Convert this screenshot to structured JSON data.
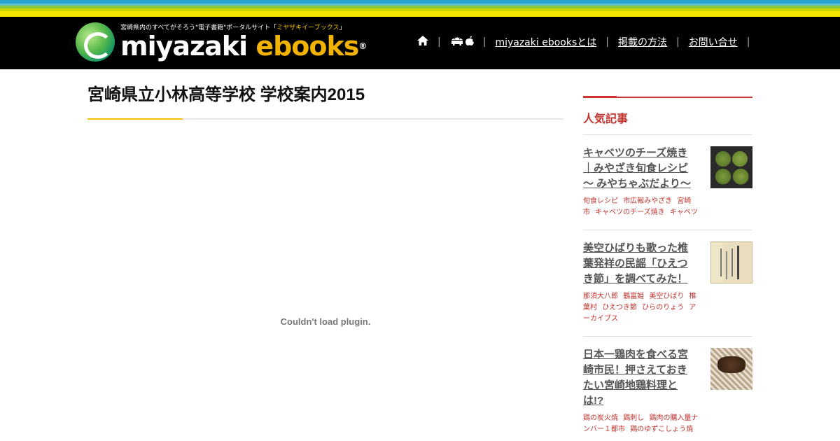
{
  "header": {
    "tagline_prefix": "宮崎県内のすべてがそろう\"電子書籍\"ポータルサイト「",
    "tagline_highlight": "ミヤザキイーブックス",
    "tagline_suffix": "」",
    "brand_part1": "miyazaki",
    "brand_part2": "ebooks",
    "brand_mark": "®"
  },
  "nav": {
    "home_icon": "home-icon",
    "apps_icon": "android-apple-icon",
    "separator": "|",
    "items": [
      {
        "label": "miyazaki ebooksとは"
      },
      {
        "label": "掲載の方法"
      },
      {
        "label": "お問い合せ"
      }
    ]
  },
  "main": {
    "title": "宮崎県立小林高等学校 学校案内2015",
    "plugin_message": "Couldn't load plugin."
  },
  "sidebar": {
    "heading": "人気記事",
    "items": [
      {
        "title": "キャベツのチーズ焼き｜みやざき旬食レシピ ～ みやちゃぶだより～",
        "tags": [
          "旬食レシピ",
          "市広報みやざき",
          "宮崎市",
          "キャベツのチーズ焼き",
          "キャベツ"
        ]
      },
      {
        "title": "美空ひばりも歌った椎葉発祥の民謡「ひえつき節」を調べてみた！",
        "tags": [
          "那須大八郎",
          "鶴富姫",
          "美空ひばり",
          "椎葉村",
          "ひえつき節",
          "ひらのりょう",
          "アーカイブス"
        ]
      },
      {
        "title": "日本一鶏肉を食べる宮崎市民！押さえておきたい宮崎地鶏料理とは!?",
        "tags": [
          "鶏の炭火焼",
          "鶏刺し",
          "鶏肉の購入量ナンバー１都市",
          "鶏のゆずこしょう焼"
        ]
      }
    ]
  }
}
